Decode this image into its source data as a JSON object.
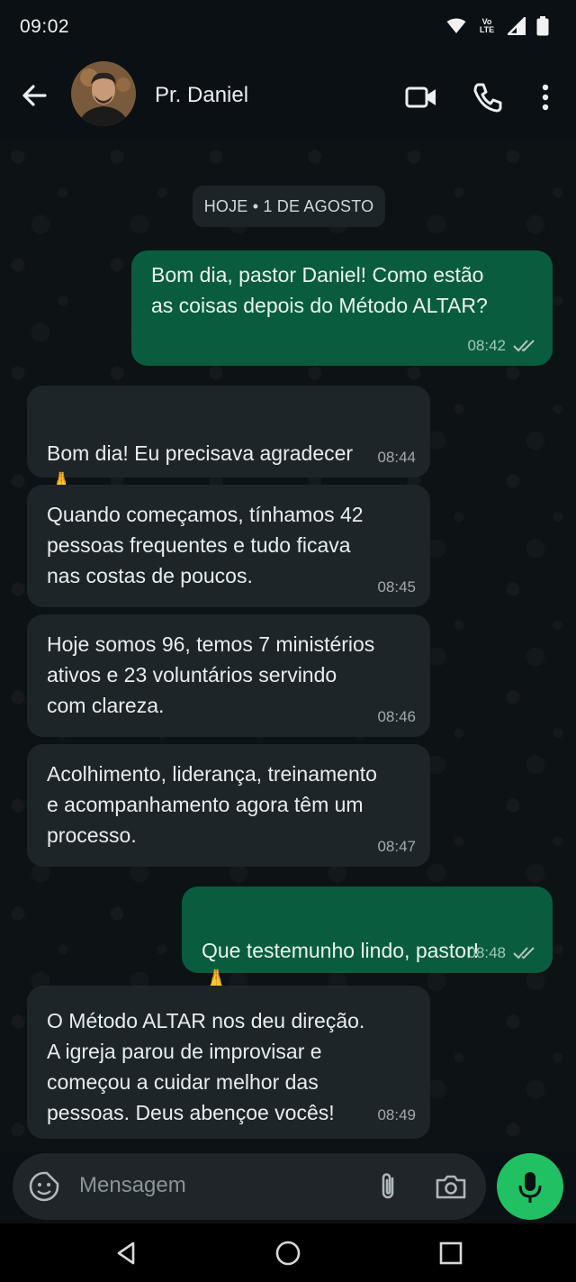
{
  "status": {
    "time": "09:02",
    "network_label": "Vo LTE"
  },
  "header": {
    "contact_name": "Pr. Daniel"
  },
  "chat": {
    "date_divider": "HOJE • 1 DE AGOSTO",
    "messages": [
      {
        "dir": "out",
        "text": "Bom dia, pastor Daniel! Como estão\nas coisas depois do Método ALTAR?",
        "time": "08:42",
        "read": true
      },
      {
        "dir": "in",
        "text": "Bom dia! Eu precisava agradecer",
        "emoji": "🙏",
        "time": "08:44"
      },
      {
        "dir": "in",
        "text": "Quando começamos, tínhamos 42\npessoas frequentes e tudo ficava\nnas costas de poucos.",
        "time": "08:45"
      },
      {
        "dir": "in",
        "text": "Hoje somos 96, temos 7 ministérios\nativos e 23 voluntários servindo\ncom clareza.",
        "time": "08:46"
      },
      {
        "dir": "in",
        "text": "Acolhimento, liderança, treinamento\ne acompanhamento agora têm um\nprocesso.",
        "time": "08:47"
      },
      {
        "dir": "out",
        "text": "Que testemunho lindo, pastor!",
        "emoji": "🙏",
        "time": "08:48",
        "read": true
      },
      {
        "dir": "in",
        "text": "O Método ALTAR nos deu direção.\nA igreja parou de improvisar e\ncomeçou a cuidar melhor das\npessoas. Deus abençoe vocês!",
        "time": "08:49"
      }
    ]
  },
  "composer": {
    "placeholder": "Mensagem"
  },
  "icons": {
    "back": "arrow-left-icon",
    "video": "video-call-icon",
    "call": "phone-icon",
    "menu": "more-vert-icon",
    "sticker": "sticker-icon",
    "attach": "paperclip-icon",
    "camera": "camera-icon",
    "mic": "mic-icon"
  },
  "colors": {
    "outgoing_bubble": "#0a5c3f",
    "incoming_bubble": "#1e2528",
    "mic_button": "#21c063",
    "background": "#0b1014"
  }
}
